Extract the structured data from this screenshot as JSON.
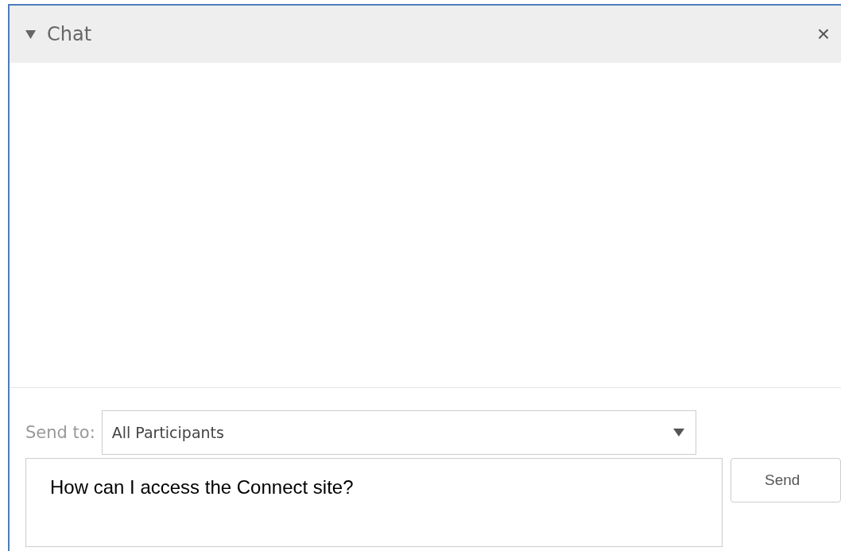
{
  "panel": {
    "title": "Chat",
    "expanded": true,
    "close": "×"
  },
  "send_to": {
    "label": "Send to:",
    "value": "All Participants"
  },
  "message": {
    "value": "How can I access the Connect site?"
  },
  "send_button": "Send"
}
